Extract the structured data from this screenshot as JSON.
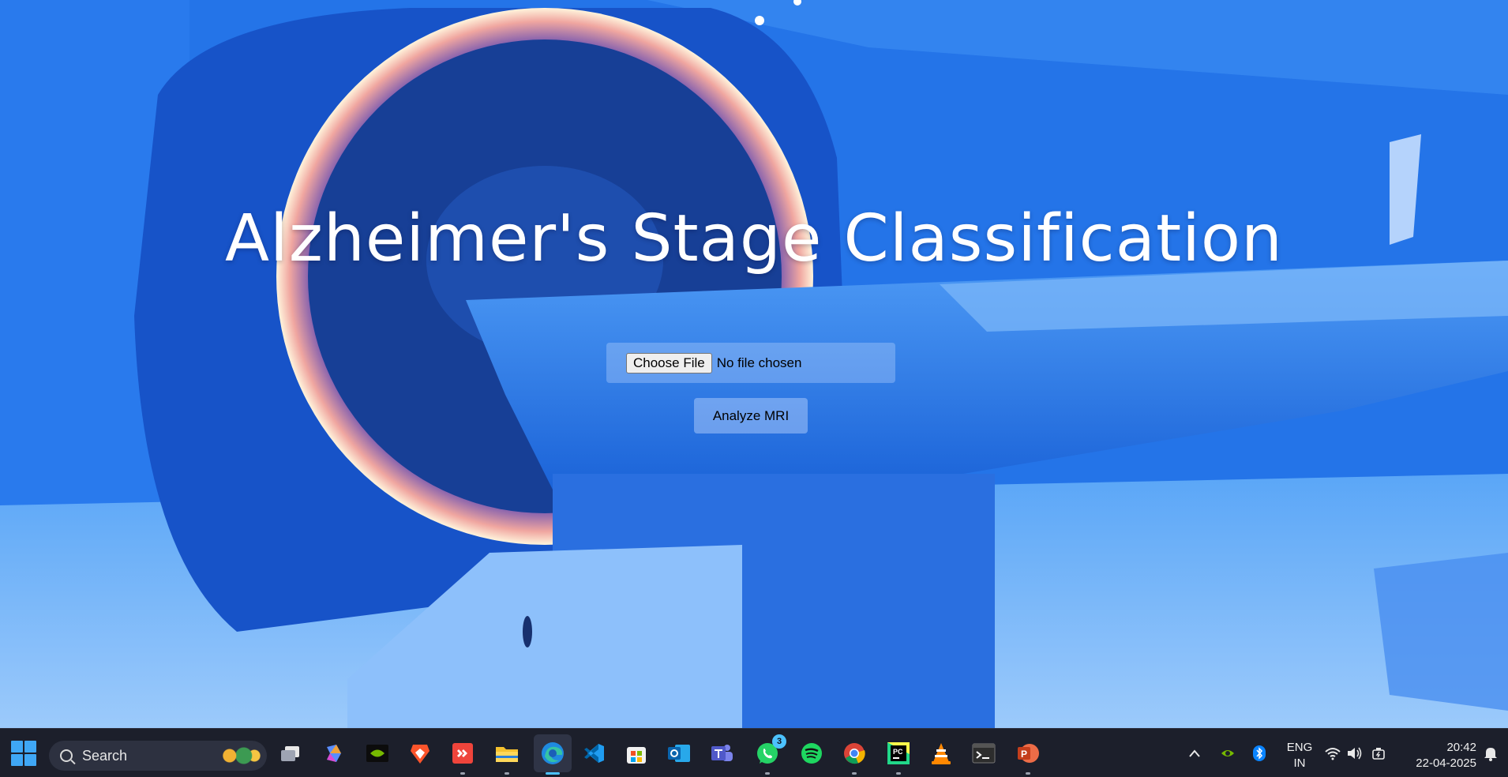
{
  "page": {
    "title": "Alzheimer's Stage Classification"
  },
  "upload": {
    "button_label": "Choose File",
    "status": "No file chosen"
  },
  "actions": {
    "analyze_label": "Analyze MRI"
  },
  "taskbar": {
    "search_label": "Search",
    "pinned_apps": [
      {
        "name": "task-view",
        "icon": "task-view-icon"
      },
      {
        "name": "copilot",
        "icon": "copilot-icon"
      },
      {
        "name": "nvidia",
        "icon": "nvidia-icon"
      },
      {
        "name": "brave",
        "icon": "brave-icon"
      },
      {
        "name": "anydesk",
        "icon": "anydesk-icon"
      },
      {
        "name": "file-explorer",
        "icon": "folder-icon"
      },
      {
        "name": "edge",
        "icon": "edge-icon"
      },
      {
        "name": "vscode",
        "icon": "vscode-icon"
      },
      {
        "name": "store",
        "icon": "store-icon"
      },
      {
        "name": "outlook",
        "icon": "outlook-icon"
      },
      {
        "name": "teams",
        "icon": "teams-icon"
      },
      {
        "name": "whatsapp",
        "icon": "whatsapp-icon",
        "badge": "3"
      },
      {
        "name": "spotify",
        "icon": "spotify-icon"
      },
      {
        "name": "chrome",
        "icon": "chrome-icon"
      },
      {
        "name": "pycharm",
        "icon": "pycharm-icon"
      },
      {
        "name": "vlc",
        "icon": "vlc-icon"
      },
      {
        "name": "terminal",
        "icon": "terminal-icon"
      },
      {
        "name": "powerpoint",
        "icon": "powerpoint-icon"
      }
    ],
    "tray": {
      "lang_line1": "ENG",
      "lang_line2": "IN",
      "time": "20:42",
      "date": "22-04-2025"
    }
  }
}
